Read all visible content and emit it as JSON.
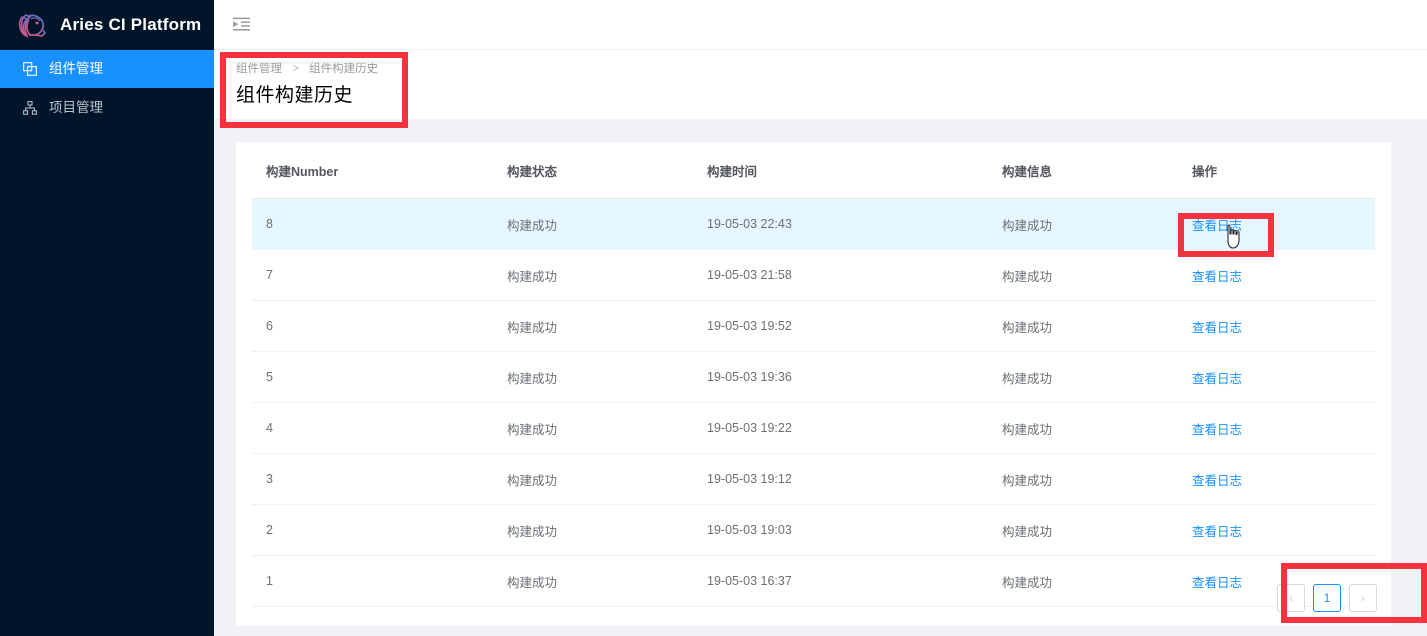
{
  "brand": {
    "name": "Aries CI Platform",
    "logo_icon": "aries-ram-head-logo",
    "logo_color_start": "#e8547c",
    "logo_color_end": "#2f86d6",
    "sidebar_bg": "#001529",
    "accent_color": "#1890ff"
  },
  "sidebar": {
    "items": [
      {
        "label": "组件管理",
        "icon": "appstore-icon",
        "active": true
      },
      {
        "label": "项目管理",
        "icon": "cluster-icon",
        "active": false
      }
    ]
  },
  "topbar": {
    "fold_icon": "menu-fold-icon"
  },
  "breadcrumb": {
    "parent": "组件管理",
    "separator": ">",
    "current": "组件构建历史"
  },
  "page": {
    "title": "组件构建历史"
  },
  "table": {
    "columns": [
      "构建Number",
      "构建状态",
      "构建时间",
      "构建信息",
      "操作"
    ],
    "action_label": "查看日志",
    "rows": [
      {
        "number": "8",
        "status": "构建成功",
        "time": "19-05-03 22:43",
        "info": "构建成功",
        "action": "查看日志",
        "highlighted": true
      },
      {
        "number": "7",
        "status": "构建成功",
        "time": "19-05-03 21:58",
        "info": "构建成功",
        "action": "查看日志",
        "highlighted": false
      },
      {
        "number": "6",
        "status": "构建成功",
        "time": "19-05-03 19:52",
        "info": "构建成功",
        "action": "查看日志",
        "highlighted": false
      },
      {
        "number": "5",
        "status": "构建成功",
        "time": "19-05-03 19:36",
        "info": "构建成功",
        "action": "查看日志",
        "highlighted": false
      },
      {
        "number": "4",
        "status": "构建成功",
        "time": "19-05-03 19:22",
        "info": "构建成功",
        "action": "查看日志",
        "highlighted": false
      },
      {
        "number": "3",
        "status": "构建成功",
        "time": "19-05-03 19:12",
        "info": "构建成功",
        "action": "查看日志",
        "highlighted": false
      },
      {
        "number": "2",
        "status": "构建成功",
        "time": "19-05-03 19:03",
        "info": "构建成功",
        "action": "查看日志",
        "highlighted": false
      },
      {
        "number": "1",
        "status": "构建成功",
        "time": "19-05-03 16:37",
        "info": "构建成功",
        "action": "查看日志",
        "highlighted": false
      }
    ]
  },
  "pagination": {
    "prev": "‹",
    "next": "›",
    "pages": [
      "1"
    ],
    "current": "1"
  },
  "annotations": {
    "color": "#f5333f",
    "boxes": [
      "breadcrumb-title-area",
      "view-log-link-row-8",
      "pagination-area"
    ]
  }
}
